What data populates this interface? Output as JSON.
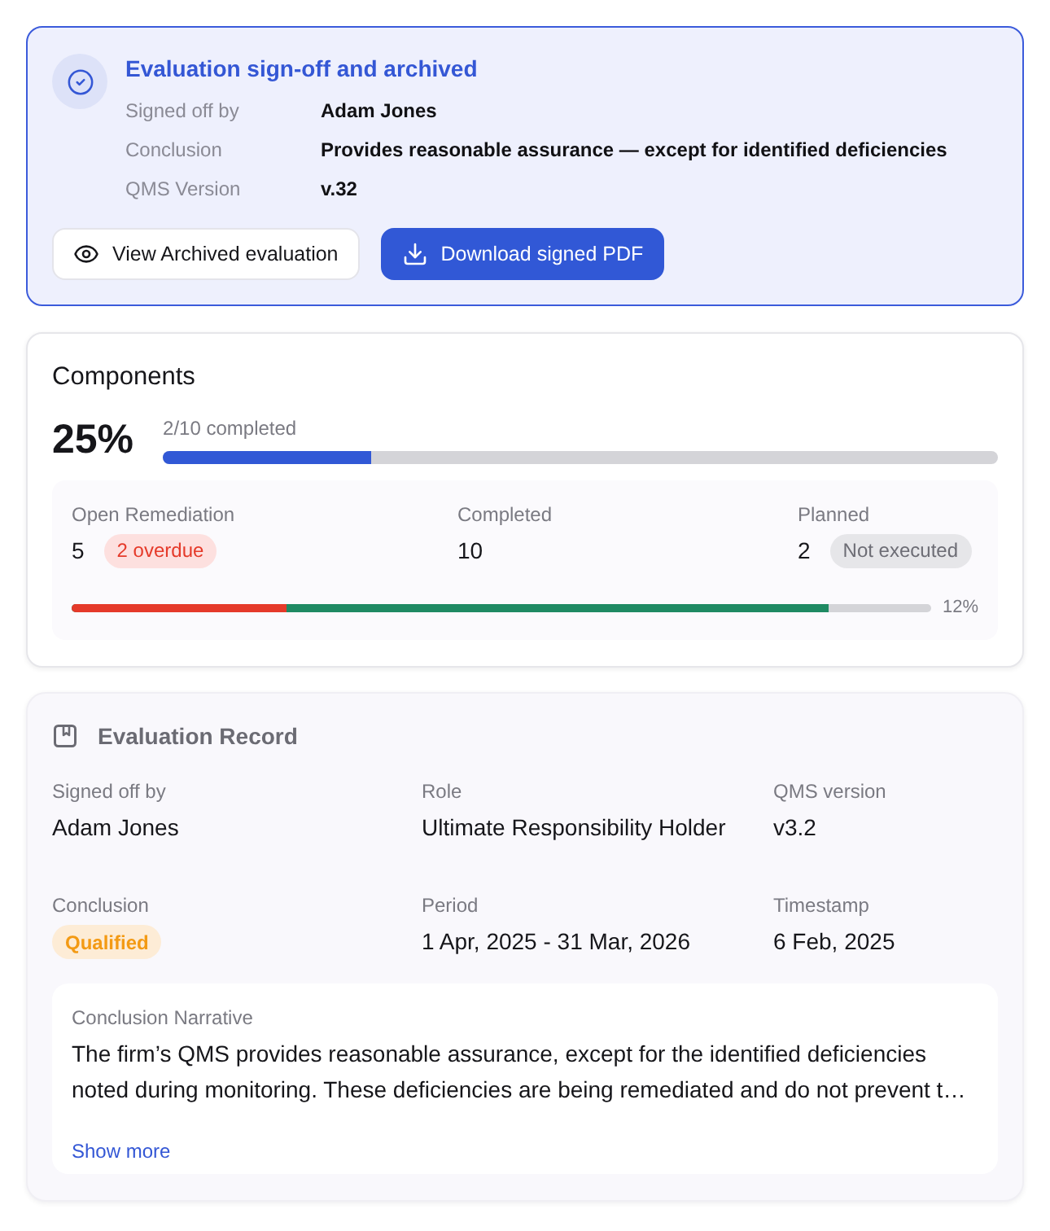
{
  "archive_banner": {
    "title": "Evaluation sign-off and archived",
    "fields": [
      {
        "label": "Signed off by",
        "value": "Adam Jones"
      },
      {
        "label": "Conclusion",
        "value": "Provides reasonable assurance — except for identified deficiencies"
      },
      {
        "label": "QMS Version",
        "value": "v.32"
      }
    ],
    "buttons": [
      {
        "kind": "secondary",
        "label": "View Archived evaluation"
      },
      {
        "kind": "primary",
        "label": "Download signed PDF"
      }
    ]
  },
  "components": {
    "title": "Components",
    "percent": "25%",
    "caption": "2/10 completed",
    "progress": {
      "level": 0.25
    },
    "stats": [
      {
        "label": "Open Remediation",
        "value": "5",
        "badge": {
          "kind": "danger",
          "text": "2 overdue"
        }
      },
      {
        "label": "Completed",
        "value": "10"
      },
      {
        "label": "Planned",
        "value": "2",
        "badge": {
          "kind": "neutral",
          "text": "Not executed"
        }
      }
    ],
    "breakdown": {
      "segments": [
        {
          "level": 0.25,
          "color": "#e53a2a"
        },
        {
          "level": 0.88,
          "color": "#1f8a63"
        }
      ],
      "reading": "12%"
    }
  },
  "evaluation_record": {
    "title": "Evaluation Record",
    "fields": [
      {
        "kind": "text",
        "label": "Signed off by",
        "value": "Adam Jones"
      },
      {
        "kind": "text",
        "label": "Role",
        "value": "Ultimate Responsibility Holder"
      },
      {
        "kind": "text",
        "label": "QMS version",
        "value": "v3.2"
      },
      {
        "kind": "badge",
        "label": "Conclusion",
        "value": "Qualified"
      },
      {
        "kind": "text",
        "label": "Period",
        "value": "1 Apr, 2025 - 31 Mar, 2026"
      },
      {
        "kind": "text",
        "label": "Timestamp",
        "value": "6 Feb, 2025"
      }
    ],
    "narrative": {
      "label": "Conclusion Narrative",
      "text": "The firm’s QMS provides reasonable assurance, except for the identified deficiencies noted during monitoring. These deficiencies are being remediated and do not prevent t…",
      "link": "Show more"
    }
  }
}
